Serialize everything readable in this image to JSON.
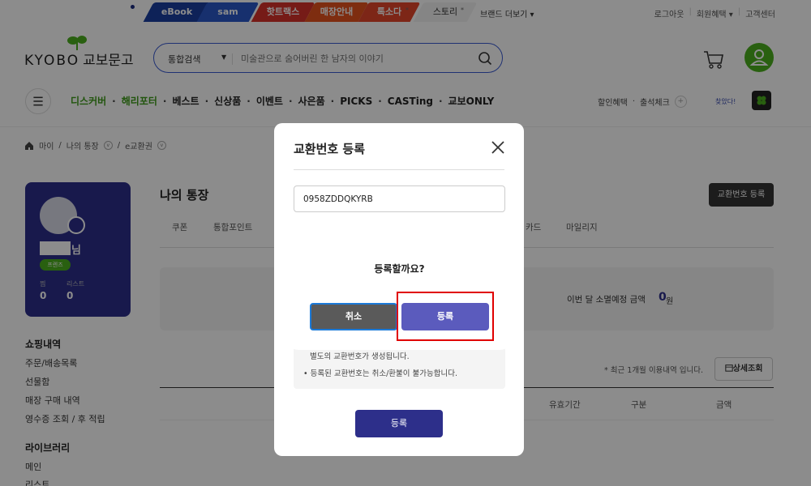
{
  "top_tabs": [
    {
      "label": "eBook",
      "color": "#1a3fa0"
    },
    {
      "label": "sam",
      "color": "#2a58c8"
    },
    {
      "label": "핫트랙스",
      "color": "#d8322a"
    },
    {
      "label": "매장안내",
      "color": "#e6521e"
    },
    {
      "label": "톡소다",
      "color": "#e3452a"
    },
    {
      "label": "스토리",
      "color": "#f2f2f2"
    }
  ],
  "brand_more": "브랜드 더보기 ▾",
  "top_links": [
    "로그아웃",
    "회원혜택 ▾",
    "고객센터"
  ],
  "logo": {
    "en": "KYOBO",
    "kr": "교보문고"
  },
  "search": {
    "category": "통합검색",
    "placeholder": "미술관으로 숨어버린 한 남자의 이야기"
  },
  "nav": {
    "items": [
      "디스커버",
      "해리포터",
      "베스트",
      "신상품",
      "이벤트",
      "사은품",
      "PICKS",
      "CASTing",
      "교보ONLY"
    ],
    "right": [
      "할인혜택",
      "출석체크"
    ],
    "small": "찾았다!"
  },
  "breadcrumb": [
    "마이",
    "나의 통장",
    "e교환권"
  ],
  "profile": {
    "suffix": "님",
    "badge": "프렌즈",
    "stats": [
      {
        "label": "찜",
        "value": "0"
      },
      {
        "label": "리스트",
        "value": "0"
      }
    ]
  },
  "sidebar": {
    "shopping_title": "쇼핑내역",
    "shopping_items": [
      "주문/배송목록",
      "선물함",
      "매장 구매 내역",
      "영수증 조회 / 후 적립"
    ],
    "library_title": "라이브러리",
    "library_items": [
      "메인",
      "리스트"
    ]
  },
  "page": {
    "title": "나의 통장",
    "register_button": "교환번호 등록",
    "tabs": [
      "쿠폰",
      "통합포인트",
      "카드",
      "마일리지"
    ],
    "expire_label": "이번 달 소멸예정 금액",
    "expire_value": "0",
    "expire_unit": "원",
    "note": "* 최근 1개월 이용내역 입니다.",
    "detail_button": "상세조회",
    "columns": [
      "유효기간",
      "구분",
      "금액"
    ]
  },
  "modal": {
    "title": "교환번호 등록",
    "input_value": "0958ZDDQKYRB",
    "notes": [
      "별도의 교환번호가 생성됩니다.",
      "• 등록된 교환번호는 취소/환불이 불가능합니다."
    ],
    "register_button": "등록"
  },
  "confirm": {
    "question": "등록할까요?",
    "cancel": "취소",
    "ok": "등록"
  }
}
